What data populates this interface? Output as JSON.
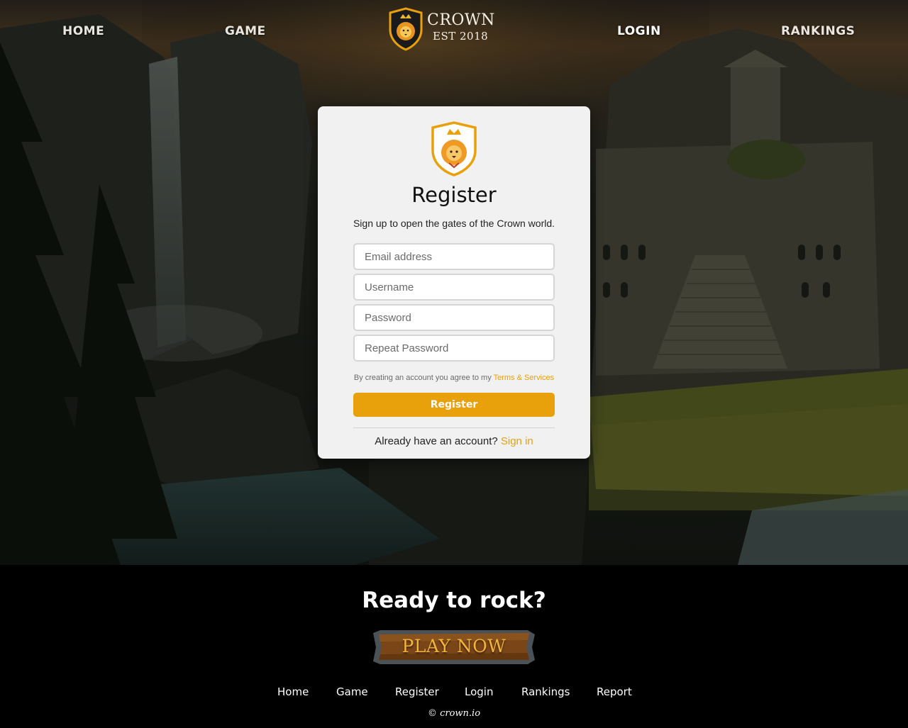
{
  "nav": {
    "home": "HOME",
    "game": "GAME",
    "login": "LOGIN",
    "rankings": "RANKINGS",
    "brand_name": "CROWN",
    "brand_est": "EST 2018"
  },
  "register": {
    "title": "Register",
    "subtitle": "Sign up to open the gates of the Crown world.",
    "email_placeholder": "Email address",
    "username_placeholder": "Username",
    "password_placeholder": "Password",
    "repeat_password_placeholder": "Repeat Password",
    "terms_prefix": "By creating an account you agree to my",
    "terms_link": "Terms & Services",
    "button": "Register",
    "signin_prefix": "Already have an account?",
    "signin_link": "Sign in"
  },
  "footer": {
    "headline": "Ready to rock?",
    "play_button": "PLAY NOW",
    "links": {
      "home": "Home",
      "game": "Game",
      "register": "Register",
      "login": "Login",
      "rankings": "Rankings",
      "report": "Report"
    },
    "copyright": "© crown.io"
  },
  "colors": {
    "accent": "#e8a00b",
    "card_bg": "#f1f1f1",
    "footer_bg": "#000000"
  },
  "icons": {
    "brand_logo": "lion-crown-shield-icon",
    "card_logo": "lion-crown-shield-icon"
  }
}
